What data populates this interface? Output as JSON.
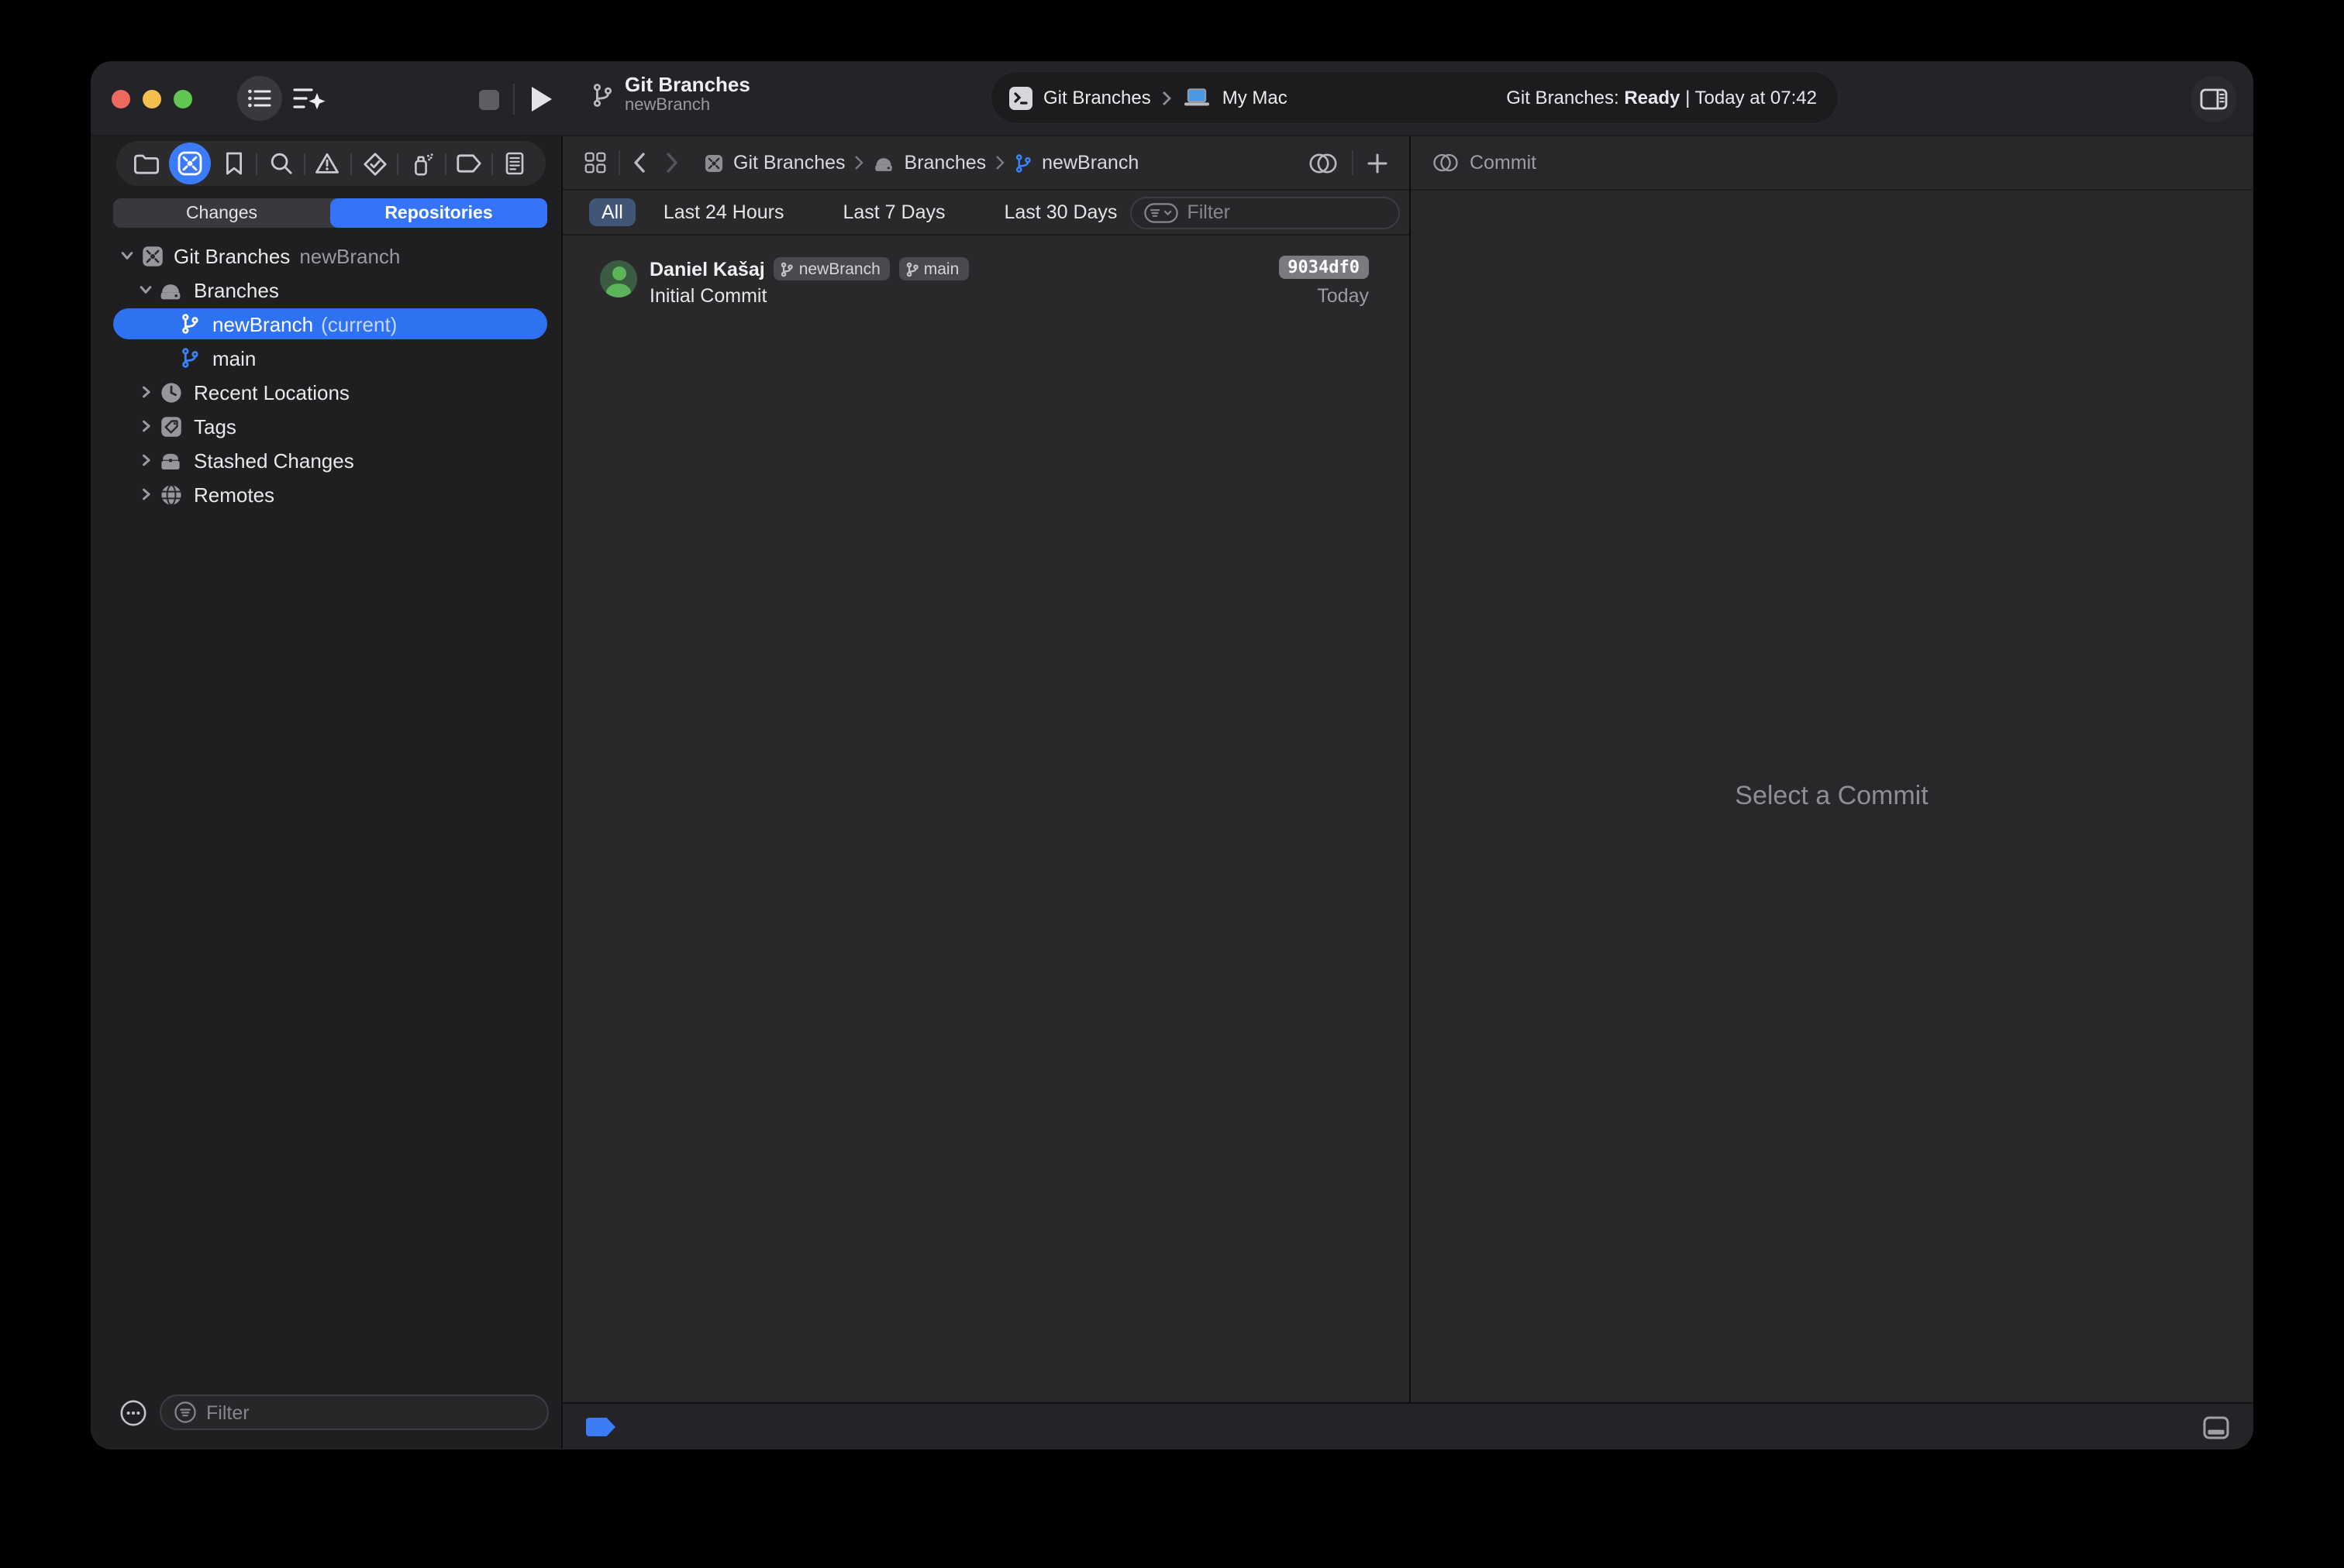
{
  "toolbar": {
    "project": {
      "title": "Git Branches",
      "subtitle": "newBranch"
    },
    "scheme": {
      "name": "Git Branches",
      "destination": "My Mac"
    },
    "status": {
      "prefix": "Git Branches:",
      "state": "Ready",
      "rest": "| Today at 07:42"
    }
  },
  "navigator": {
    "tabs": [
      "folder",
      "source-control",
      "bookmarks",
      "find",
      "issues",
      "tests",
      "debug",
      "breakpoints",
      "reports"
    ],
    "selected_tab": "source-control",
    "segmented": {
      "options": [
        "Changes",
        "Repositories"
      ],
      "selected": "Repositories"
    },
    "tree": [
      {
        "label": "Git Branches",
        "secondary": "newBranch",
        "icon": "repo",
        "depth": 0,
        "expanded": true
      },
      {
        "label": "Branches",
        "icon": "drive",
        "depth": 1,
        "expanded": true
      },
      {
        "label": "newBranch",
        "suffix": "(current)",
        "icon": "git-branch",
        "depth": 2,
        "selected": true
      },
      {
        "label": "main",
        "icon": "git-branch",
        "depth": 2
      },
      {
        "label": "Recent Locations",
        "icon": "clock",
        "depth": 1,
        "expanded": false
      },
      {
        "label": "Tags",
        "icon": "tag",
        "depth": 1,
        "expanded": false
      },
      {
        "label": "Stashed Changes",
        "icon": "stash",
        "depth": 1,
        "expanded": false
      },
      {
        "label": "Remotes",
        "icon": "globe",
        "depth": 1,
        "expanded": false
      }
    ],
    "filter_placeholder": "Filter"
  },
  "editor": {
    "breadcrumbs": [
      {
        "label": "Git Branches",
        "icon": "repo"
      },
      {
        "label": "Branches",
        "icon": "drive"
      },
      {
        "label": "newBranch",
        "icon": "git-branch"
      }
    ],
    "time_filters": [
      "All",
      "Last 24 Hours",
      "Last 7 Days",
      "Last 30 Days"
    ],
    "selected_filter": "All",
    "filter_placeholder": "Filter",
    "commits": [
      {
        "author": "Daniel Kašaj",
        "branches": [
          "newBranch",
          "main"
        ],
        "message": "Initial Commit",
        "hash": "9034df0",
        "date": "Today"
      }
    ]
  },
  "inspector": {
    "title": "Commit",
    "empty_state": "Select a Commit"
  },
  "colors": {
    "accent": "#3574f6",
    "selected_row": "#2e72f2",
    "selected_chip": "#415677",
    "avatar_green": "#5bb457",
    "badge_gray": "#49494e",
    "hash_badge": "#7a7a80"
  }
}
